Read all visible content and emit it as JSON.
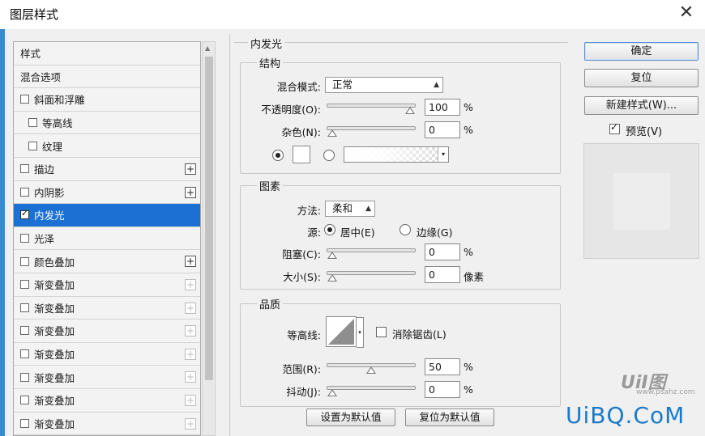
{
  "window": {
    "title": "图层样式",
    "close_label": "✕"
  },
  "style_list": {
    "items": [
      {
        "label": "样式",
        "checkbox": false,
        "plus": "none",
        "indent": 0,
        "selected": false
      },
      {
        "label": "混合选项",
        "checkbox": false,
        "plus": "none",
        "indent": 0,
        "selected": false
      },
      {
        "label": "斜面和浮雕",
        "checkbox": true,
        "plus": "none",
        "indent": 0,
        "selected": false
      },
      {
        "label": "等高线",
        "checkbox": true,
        "plus": "none",
        "indent": 1,
        "selected": false
      },
      {
        "label": "纹理",
        "checkbox": true,
        "plus": "none",
        "indent": 1,
        "selected": false
      },
      {
        "label": "描边",
        "checkbox": true,
        "plus": "active",
        "indent": 0,
        "selected": false
      },
      {
        "label": "内阴影",
        "checkbox": true,
        "plus": "active",
        "indent": 0,
        "selected": false
      },
      {
        "label": "内发光",
        "checkbox": true,
        "plus": "none",
        "indent": 0,
        "selected": true
      },
      {
        "label": "光泽",
        "checkbox": true,
        "plus": "none",
        "indent": 0,
        "selected": false
      },
      {
        "label": "颜色叠加",
        "checkbox": true,
        "plus": "active",
        "indent": 0,
        "selected": false
      },
      {
        "label": "渐变叠加",
        "checkbox": true,
        "plus": "dim",
        "indent": 0,
        "selected": false
      },
      {
        "label": "渐变叠加",
        "checkbox": true,
        "plus": "dim",
        "indent": 0,
        "selected": false
      },
      {
        "label": "渐变叠加",
        "checkbox": true,
        "plus": "dim",
        "indent": 0,
        "selected": false
      },
      {
        "label": "渐变叠加",
        "checkbox": true,
        "plus": "dim",
        "indent": 0,
        "selected": false
      },
      {
        "label": "渐变叠加",
        "checkbox": true,
        "plus": "dim",
        "indent": 0,
        "selected": false
      },
      {
        "label": "渐变叠加",
        "checkbox": true,
        "plus": "dim",
        "indent": 0,
        "selected": false
      },
      {
        "label": "渐变叠加",
        "checkbox": true,
        "plus": "dim",
        "indent": 0,
        "selected": false
      }
    ]
  },
  "panel": {
    "title": "内发光",
    "structure": {
      "title": "结构",
      "blend_mode_label": "混合模式:",
      "blend_mode_value": "正常",
      "opacity_label": "不透明度(O):",
      "opacity_value": "100",
      "opacity_fraction": 1.0,
      "noise_label": "杂色(N):",
      "noise_value": "0",
      "noise_fraction": 0.0,
      "percent": "%"
    },
    "elements": {
      "title": "图素",
      "method_label": "方法:",
      "method_value": "柔和",
      "source_label": "源:",
      "source_center": "居中(E)",
      "source_edge": "边缘(G)",
      "choke_label": "阻塞(C):",
      "choke_value": "0",
      "choke_fraction": 0.0,
      "size_label": "大小(S):",
      "size_value": "0",
      "size_fraction": 0.0,
      "percent": "%",
      "px_unit": "像素"
    },
    "quality": {
      "title": "品质",
      "contour_label": "等高线:",
      "antialias_label": "消除锯齿(L)",
      "range_label": "范围(R):",
      "range_value": "50",
      "range_fraction": 0.5,
      "jitter_label": "抖动(J):",
      "jitter_value": "0",
      "jitter_fraction": 0.0,
      "percent": "%"
    },
    "set_default": "设置为默认值",
    "reset_default": "复位为默认值"
  },
  "right": {
    "ok": "确定",
    "reset": "复位",
    "new_style": "新建样式(W)...",
    "preview_label": "预览(V)",
    "preview_checked": true
  },
  "watermark": {
    "text": "UiBQ.CoM",
    "small": "UiI图",
    "url": "www.psahz.com"
  },
  "colors": {
    "selection": "#1c70d3",
    "accent": "#3c89d0",
    "watermark": "#1b7ac9"
  }
}
